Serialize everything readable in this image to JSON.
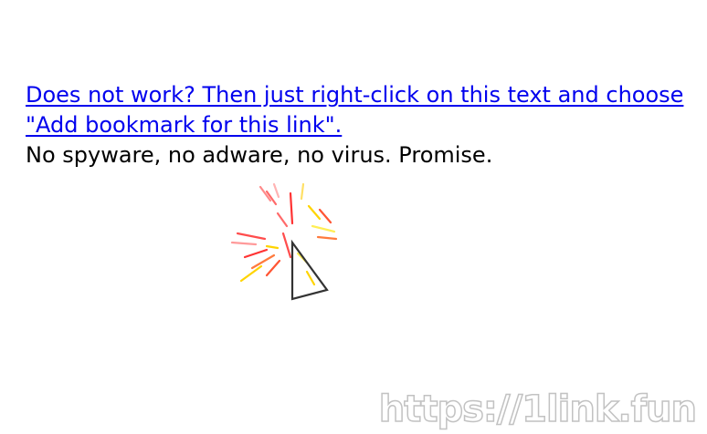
{
  "main": {
    "link_text": "Does not work? Then just right-click on this text and choose \"Add bookmark for this link\".",
    "note_text": "No spyware, no adware, no virus. Promise."
  },
  "cursor": {
    "icon": "arrow-cursor-icon",
    "sparkle_icon": "sparkle-burst-icon",
    "colors": [
      "#ff3333",
      "#ff7a3d",
      "#ffd400",
      "#ffee55"
    ]
  },
  "watermark": {
    "text": "https://1link.fun"
  }
}
